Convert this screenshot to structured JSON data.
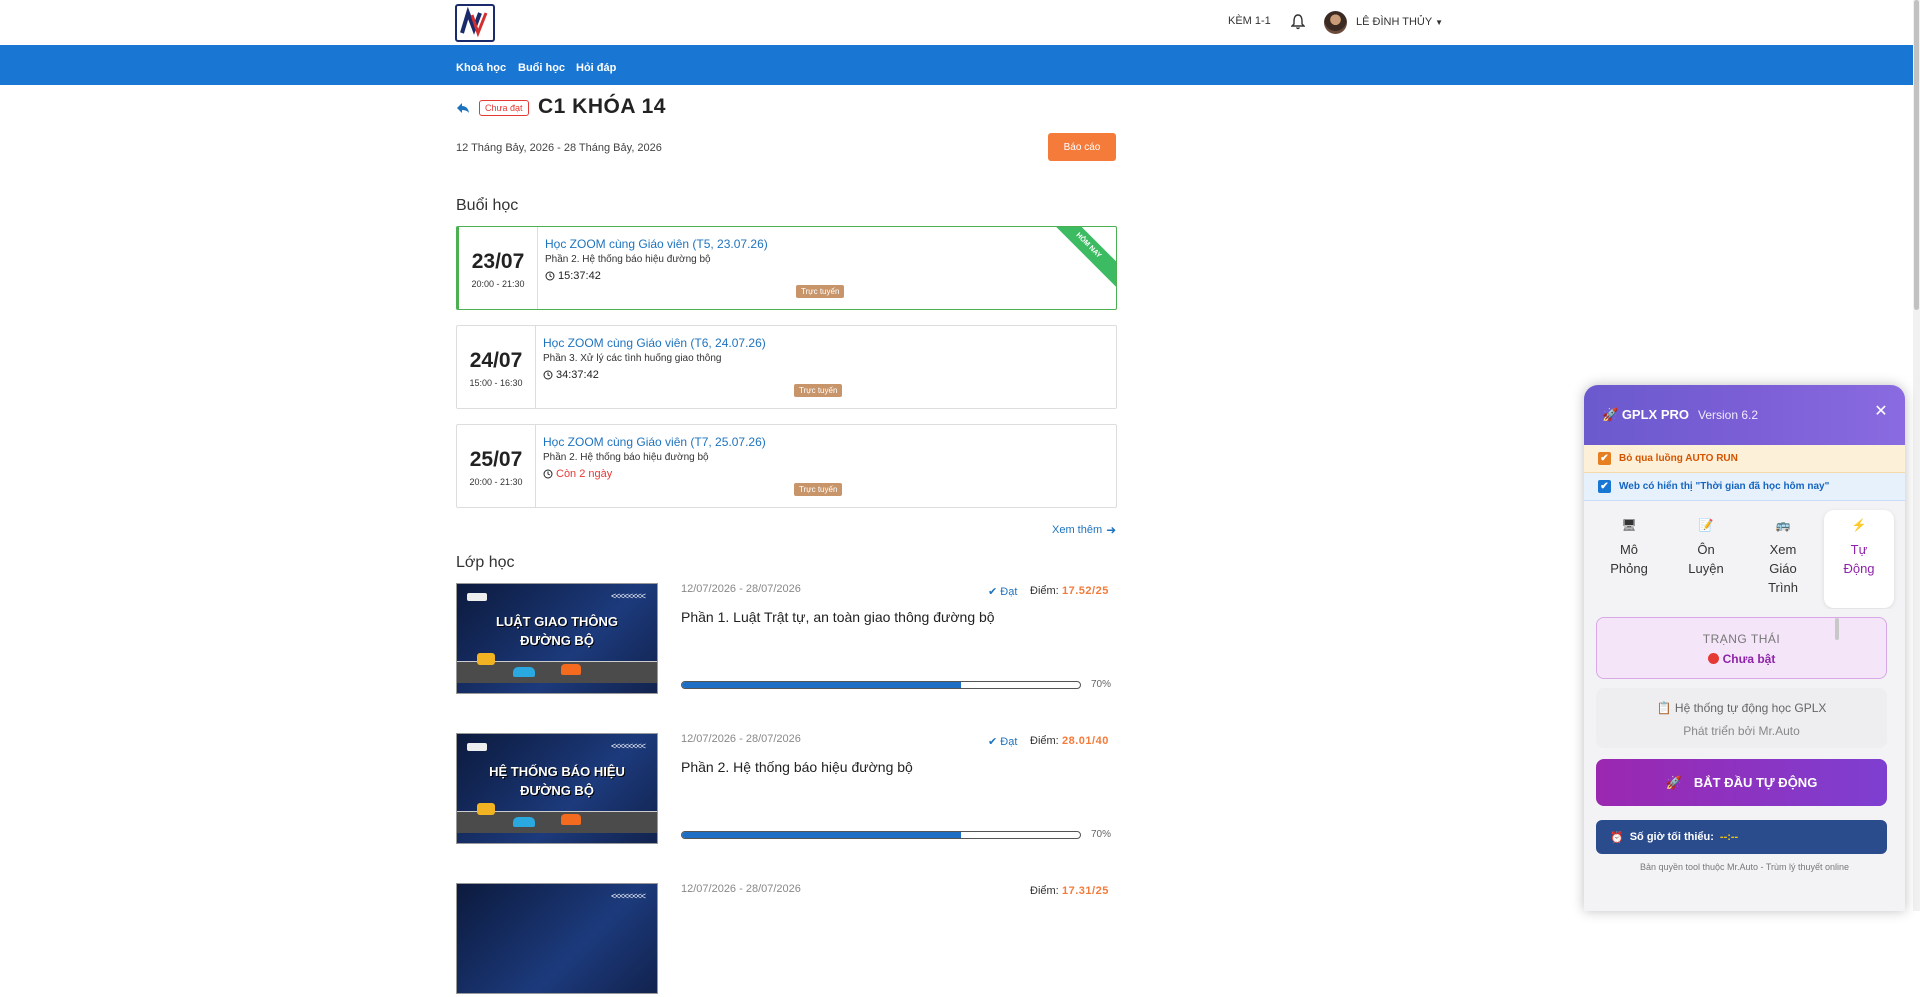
{
  "header": {
    "user_badge": "KÈM 1-1",
    "username": "LÊ ĐÌNH THỦY"
  },
  "nav": {
    "items": [
      "Khoá học",
      "Buổi học",
      "Hỏi đáp"
    ]
  },
  "course": {
    "status_badge": "Chưa đạt",
    "title": "C1 KHÓA 14",
    "date_range": "12 Tháng Bảy, 2026 - 28 Tháng Bảy, 2026",
    "report_label": "Báo cáo"
  },
  "sessions_section": {
    "title": "Buổi học",
    "see_more": "Xem thêm",
    "items": [
      {
        "day": "23/07",
        "time": "20:00 - 21:30",
        "title": "Học ZOOM cùng Giáo viên (T5, 23.07.26)",
        "subtitle": "Phần 2. Hệ thống báo hiệu đường bộ",
        "countdown": "15:37:42",
        "mode": "Trực tuyến",
        "ribbon": "HÔM NAY"
      },
      {
        "day": "24/07",
        "time": "15:00 - 16:30",
        "title": "Học ZOOM cùng Giáo viên (T6, 24.07.26)",
        "subtitle": "Phần 3. Xử lý các tình huống giao thông",
        "countdown": "34:37:42",
        "mode": "Trực tuyến"
      },
      {
        "day": "25/07",
        "time": "20:00 - 21:30",
        "title": "Học ZOOM cùng Giáo viên (T7, 25.07.26)",
        "subtitle": "Phần 2. Hệ thống báo hiệu đường bộ",
        "countdown": "Còn 2 ngày",
        "mode": "Trực tuyến"
      }
    ]
  },
  "classes_section": {
    "title": "Lớp học",
    "score_label": "Điểm:",
    "items": [
      {
        "thumb_line1": "LUẬT GIAO THÔNG",
        "thumb_line2": "ĐƯỜNG BỘ",
        "date": "12/07/2026 - 28/07/2026",
        "status": "Đạt",
        "score": "17.52/25",
        "title": "Phần 1. Luật Trật tự, an toàn giao thông đường bộ",
        "progress": 0.7,
        "progress_label": "70%"
      },
      {
        "thumb_line1": "HỆ THỐNG BÁO HIỆU",
        "thumb_line2": "ĐƯỜNG BỘ",
        "date": "12/07/2026 - 28/07/2026",
        "status": "Đạt",
        "score": "28.01/40",
        "title": "Phần 2. Hệ thống báo hiệu đường bộ",
        "progress": 0.7,
        "progress_label": "70%"
      },
      {
        "date": "12/07/2026 - 28/07/2026",
        "score": "17.31/25"
      }
    ]
  },
  "extension": {
    "title": "GPLX PRO",
    "version": "Version 6.2",
    "option1": "Bỏ qua luồng AUTO RUN",
    "option2": "Web có hiển thị \"Thời gian đã học hôm nay\"",
    "tabs": [
      {
        "line1": "Mô",
        "line2": "Phỏng",
        "line3": ""
      },
      {
        "line1": "Ôn",
        "line2": "Luyện",
        "line3": ""
      },
      {
        "line1": "Xem",
        "line2": "Giáo",
        "line3": "Trình"
      },
      {
        "line1": "Tự",
        "line2": "Động",
        "line3": ""
      }
    ],
    "status_label": "TRẠNG THÁI",
    "status_value": "Chưa bật",
    "info_line1": "Hệ thống tự động học GPLX",
    "info_line2": "Phát triển bởi Mr.Auto",
    "start_button": "BẮT ĐẦU TỰ ĐỘNG",
    "min_hours_label": "Số giờ tối thiểu:",
    "min_hours_value": "--:--",
    "copyright": "Bản quyền tool thuộc Mr.Auto - Trùm lý thuyết online",
    "accent_color": "#8e24aa"
  }
}
